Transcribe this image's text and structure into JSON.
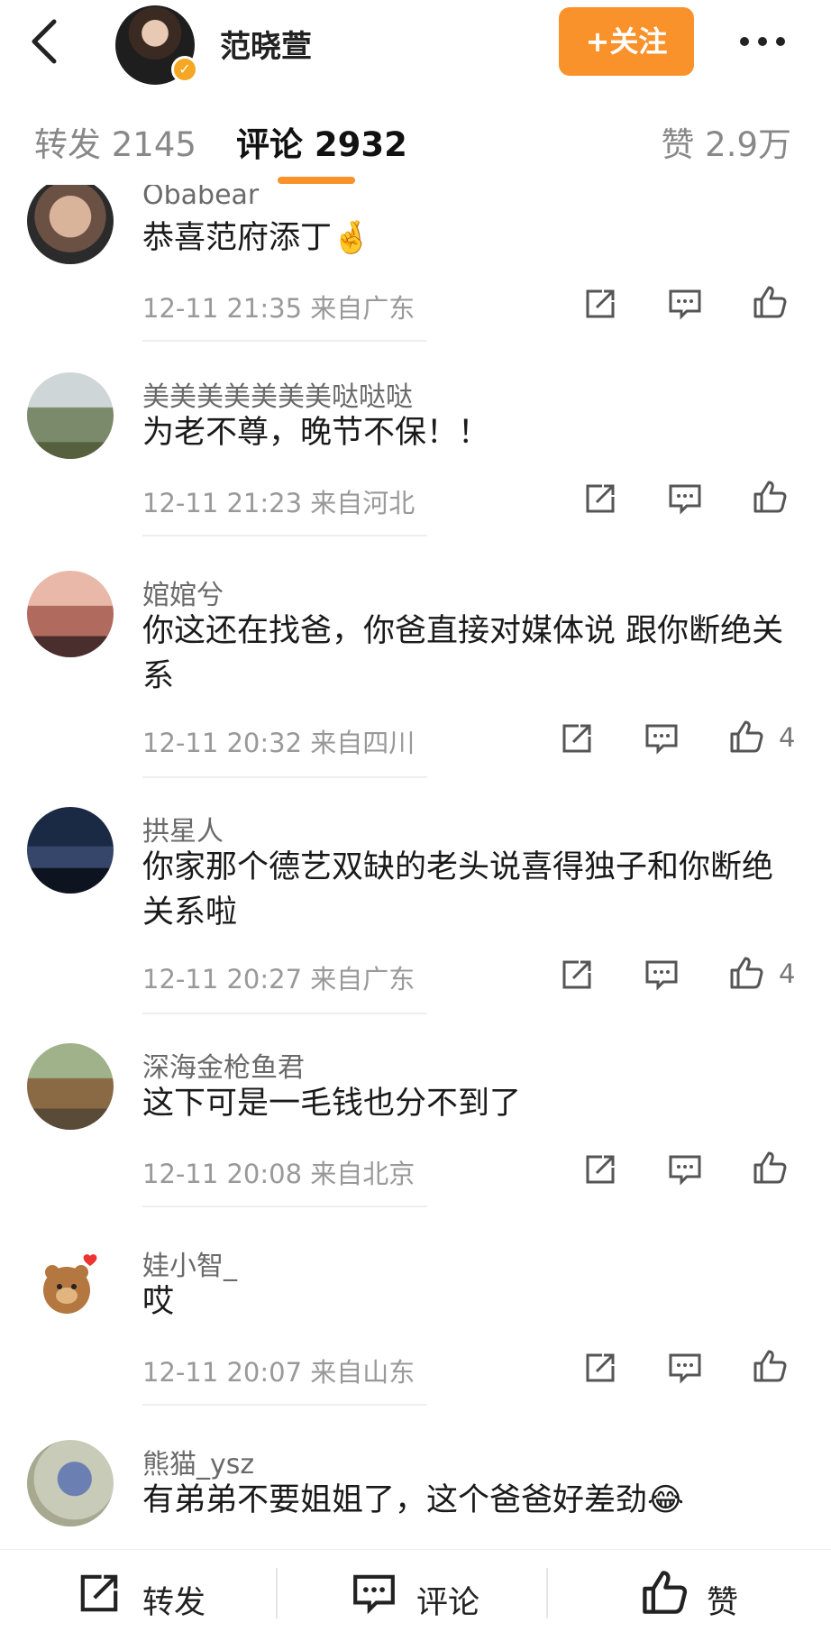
{
  "header": {
    "title": "范晓萱",
    "follow_label": "+关注"
  },
  "tabs": {
    "repost": "转发 2145",
    "comment": "评论 2932",
    "like": "赞 2.9万"
  },
  "comments": [
    {
      "name": "Obabear",
      "text": "恭喜范府添丁🤞",
      "meta": "12-11 21:35 来自广东",
      "likes": ""
    },
    {
      "name": "美美美美美美美哒哒哒",
      "text": "为老不尊，晚节不保！！",
      "meta": "12-11 21:23 来自河北",
      "likes": ""
    },
    {
      "name": "婠婠兮",
      "text": "你这还在找爸，你爸直接对媒体说 跟你断绝关系",
      "meta": "12-11 20:32 来自四川",
      "likes": "4"
    },
    {
      "name": "拱星人",
      "text": "你家那个德艺双缺的老头说喜得独子和你断绝关系啦",
      "meta": "12-11 20:27 来自广东",
      "likes": "4"
    },
    {
      "name": "深海金枪鱼君",
      "text": "这下可是一毛钱也分不到了",
      "meta": "12-11 20:08 来自北京",
      "likes": ""
    },
    {
      "name": "娃小智_",
      "text": "哎",
      "meta": "12-11 20:07 来自山东",
      "likes": ""
    },
    {
      "name": "熊猫_ysz",
      "text": "有弟弟不要姐姐了，这个爸爸好差劲😂",
      "meta": "",
      "likes": ""
    }
  ],
  "bottom": {
    "repost": "转发",
    "comment": "评论",
    "like": "赞"
  },
  "colors": {
    "accent": "#f9922b",
    "muted": "#999999"
  },
  "icons": {
    "back": "chevron-left-icon",
    "more": "more-dots-icon",
    "repost": "repost-icon",
    "comment": "comment-icon",
    "like": "thumb-up-icon"
  }
}
